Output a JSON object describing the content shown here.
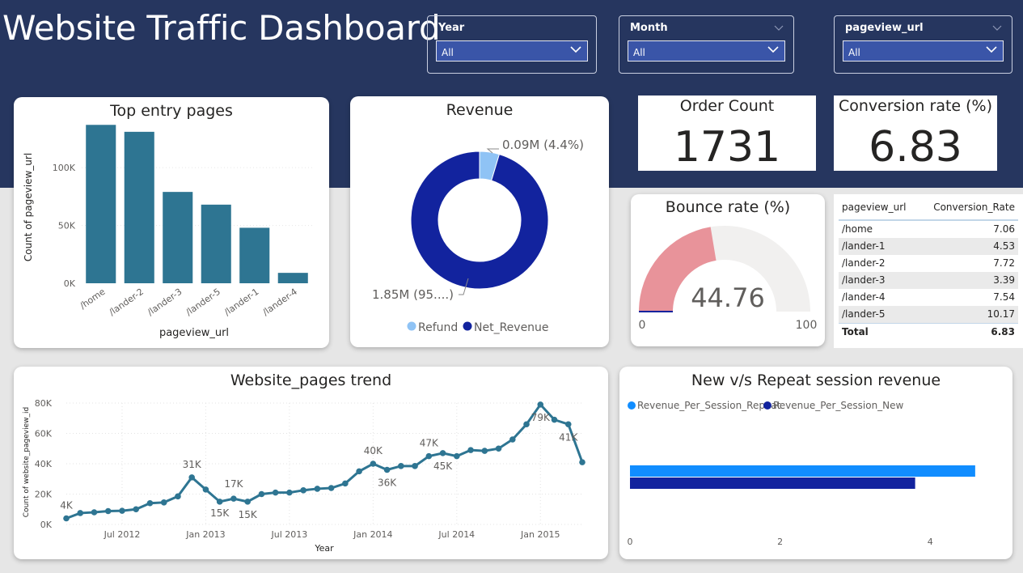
{
  "header": {
    "title": "Website Traffic Dashboard"
  },
  "slicers": [
    {
      "label": "Year",
      "value": "All"
    },
    {
      "label": "Month",
      "value": "All"
    },
    {
      "label": "pageview_url",
      "value": "All"
    }
  ],
  "kpis": {
    "order_count": {
      "title": "Order Count",
      "value": "1731"
    },
    "conversion_rate": {
      "title": "Conversion rate (%)",
      "value": "6.83"
    }
  },
  "colors": {
    "header_bg": "#26365f",
    "bar": "#2e7592",
    "donut_refund": "#8fc3f5",
    "donut_net": "#12239e",
    "gauge_fill": "#e8939a",
    "gauge_bg": "#f1f0ef",
    "line": "#2e7592",
    "repeat": "#118dff",
    "new": "#12239e"
  },
  "chart_data": [
    {
      "type": "bar",
      "title": "Top entry pages",
      "xlabel": "pageview_url",
      "ylabel": "Count of pageview_url",
      "categories": [
        "/home",
        "/lander-2",
        "/lander-3",
        "/lander-5",
        "/lander-1",
        "/lander-4"
      ],
      "values": [
        137000,
        131000,
        79000,
        68000,
        48000,
        9000
      ],
      "ylim": [
        0,
        140000
      ],
      "ytick_values": [
        0,
        50000,
        100000
      ],
      "ytick_labels": [
        "0K",
        "50K",
        "100K"
      ],
      "grid": true
    },
    {
      "type": "pie",
      "title": "Revenue",
      "categories": [
        "Refund",
        "Net_Revenue"
      ],
      "values": [
        0.09,
        1.85
      ],
      "data_labels": [
        "0.09M (4.4%)",
        "1.85M (95....)"
      ],
      "legend": [
        "Refund",
        "Net_Revenue"
      ],
      "legend_position": "bottom"
    },
    {
      "type": "gauge",
      "title": "Bounce rate (%)",
      "value": 44.76,
      "value_label": "44.76",
      "min": 0,
      "max": 100,
      "min_label": "0",
      "max_label": "100"
    },
    {
      "type": "table",
      "columns": [
        "pageview_url",
        "Conversion_Rate"
      ],
      "rows": [
        [
          "/home",
          "7.06"
        ],
        [
          "/lander-1",
          "4.53"
        ],
        [
          "/lander-2",
          "7.72"
        ],
        [
          "/lander-3",
          "3.39"
        ],
        [
          "/lander-4",
          "7.54"
        ],
        [
          "/lander-5",
          "10.17"
        ]
      ],
      "total": [
        "Total",
        "6.83"
      ]
    },
    {
      "type": "line",
      "title": "Website_pages trend",
      "xlabel": "Year",
      "ylabel": "Count of website_pageview_id",
      "x": [
        "2012-03",
        "2012-04",
        "2012-05",
        "2012-06",
        "2012-07",
        "2012-08",
        "2012-09",
        "2012-10",
        "2012-11",
        "2012-12",
        "2013-01",
        "2013-02",
        "2013-03",
        "2013-04",
        "2013-05",
        "2013-06",
        "2013-07",
        "2013-08",
        "2013-09",
        "2013-10",
        "2013-11",
        "2013-12",
        "2014-01",
        "2014-02",
        "2014-03",
        "2014-04",
        "2014-05",
        "2014-06",
        "2014-07",
        "2014-08",
        "2014-09",
        "2014-10",
        "2014-11",
        "2014-12",
        "2015-01",
        "2015-02",
        "2015-03"
      ],
      "y": [
        4000,
        7500,
        8000,
        8800,
        9000,
        10000,
        14000,
        14500,
        18500,
        31000,
        23000,
        15000,
        17000,
        15000,
        20000,
        21000,
        21000,
        22500,
        23500,
        24000,
        27000,
        35000,
        40000,
        36000,
        38500,
        38500,
        45000,
        47000,
        45000,
        49000,
        48500,
        50000,
        56000,
        66000,
        79000,
        69000,
        66000,
        41000
      ],
      "point_labels": [
        {
          "x": "2012-03",
          "label": "4K"
        },
        {
          "x": "2012-12",
          "label": "31K"
        },
        {
          "x": "2013-02",
          "label": "15K"
        },
        {
          "x": "2013-03",
          "label": "17K"
        },
        {
          "x": "2013-04",
          "label": "15K"
        },
        {
          "x": "2014-01",
          "label": "40K"
        },
        {
          "x": "2014-02",
          "label": "36K"
        },
        {
          "x": "2014-05",
          "label": "47K"
        },
        {
          "x": "2014-06",
          "label": "45K"
        },
        {
          "x": "2015-01",
          "label": "79K"
        },
        {
          "x": "2015-03",
          "label": "41K"
        }
      ],
      "xtick_labels": [
        "Jul 2012",
        "Jan 2013",
        "Jul 2013",
        "Jan 2014",
        "Jul 2014",
        "Jan 2015"
      ],
      "ylim": [
        0,
        80000
      ],
      "ytick_labels": [
        "0K",
        "20K",
        "40K",
        "60K",
        "80K"
      ],
      "grid": true
    },
    {
      "type": "bar",
      "orientation": "horizontal",
      "title": "New v/s Repeat session revenue",
      "series": [
        {
          "name": "Revenue_Per_Session_Repeat",
          "values": [
            4.6
          ]
        },
        {
          "name": "Revenue_Per_Session_New",
          "values": [
            3.8
          ]
        }
      ],
      "xlim": [
        0,
        5
      ],
      "xtick_labels": [
        "0",
        "2",
        "4"
      ],
      "legend_position": "top-left"
    }
  ]
}
